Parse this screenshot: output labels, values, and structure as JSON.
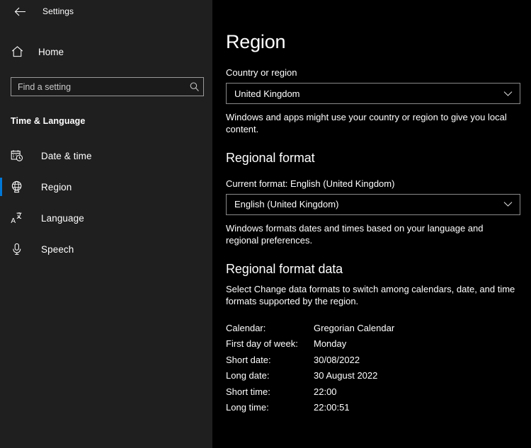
{
  "window": {
    "app_title": "Settings",
    "back_icon": "back-arrow-icon"
  },
  "sidebar": {
    "home": {
      "label": "Home",
      "icon": "home-icon"
    },
    "search": {
      "placeholder": "Find a setting",
      "value": "",
      "icon": "search-icon"
    },
    "group_title": "Time & Language",
    "items": [
      {
        "label": "Date & time",
        "icon": "calendar-clock-icon",
        "selected": false
      },
      {
        "label": "Region",
        "icon": "globe-region-icon",
        "selected": true
      },
      {
        "label": "Language",
        "icon": "language-icon",
        "selected": false
      },
      {
        "label": "Speech",
        "icon": "microphone-icon",
        "selected": false
      }
    ],
    "accent_color": "#0078d7",
    "background_color": "#1f1f1f"
  },
  "main": {
    "page_title": "Region",
    "background_color": "#000000",
    "country": {
      "label": "Country or region",
      "value": "United Kingdom",
      "chevron_icon": "chevron-down-icon",
      "helper": "Windows and apps might use your country or region to give you local content."
    },
    "regional_format": {
      "heading": "Regional format",
      "current_format": "Current format: English (United Kingdom)",
      "value": "English (United Kingdom)",
      "chevron_icon": "chevron-down-icon",
      "helper": "Windows formats dates and times based on your language and regional preferences."
    },
    "regional_format_data": {
      "heading": "Regional format data",
      "description": "Select Change data formats to switch among calendars, date, and time formats supported by the region.",
      "rows": [
        {
          "key": "Calendar:",
          "value": "Gregorian Calendar"
        },
        {
          "key": "First day of week:",
          "value": "Monday"
        },
        {
          "key": "Short date:",
          "value": "30/08/2022"
        },
        {
          "key": "Long date:",
          "value": "30 August 2022"
        },
        {
          "key": "Short time:",
          "value": "22:00"
        },
        {
          "key": "Long time:",
          "value": "22:00:51"
        }
      ]
    }
  }
}
